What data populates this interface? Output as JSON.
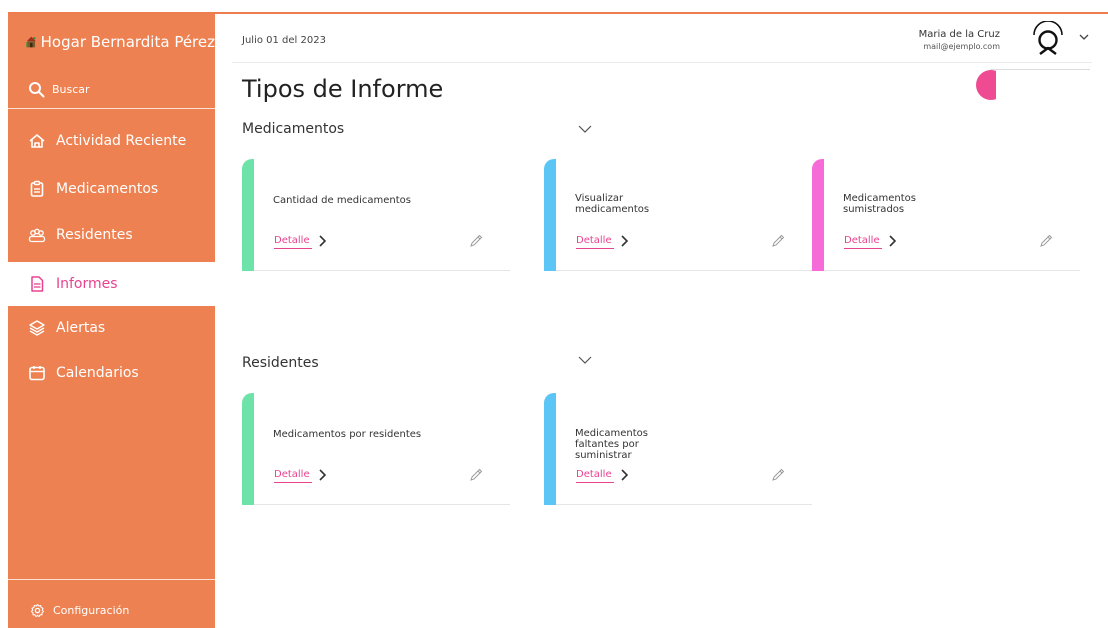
{
  "sidebar": {
    "brand": "Hogar Bernardita Pérez",
    "search_label": "Buscar",
    "items": [
      {
        "label": "Actividad Reciente",
        "icon": "home-icon"
      },
      {
        "label": "Medicamentos",
        "icon": "clipboard-icon"
      },
      {
        "label": "Residentes",
        "icon": "people-icon"
      },
      {
        "label": "Informes",
        "icon": "document-icon",
        "active": true
      },
      {
        "label": "Alertas",
        "icon": "layers-icon"
      },
      {
        "label": "Calendarios",
        "icon": "calendar-icon"
      }
    ],
    "config_label": "Configuración"
  },
  "header": {
    "date": "Julio 01 del 2023",
    "user_name": "Maria de la Cruz",
    "user_email": "mail@ejemplo.com"
  },
  "main": {
    "title": "Tipos de Informe",
    "sections": [
      {
        "title": "Medicamentos",
        "cards": [
          {
            "title": "Cantidad de medicamentos",
            "link": "Detalle",
            "color": "#6ee3a9"
          },
          {
            "title": "Visualizar medicamentos",
            "link": "Detalle",
            "color": "#5bc5f5"
          },
          {
            "title": "Medicamentos sumistrados",
            "link": "Detalle",
            "color": "#f76bd9"
          }
        ]
      },
      {
        "title": "Residentes",
        "cards": [
          {
            "title": "Medicamentos por residentes",
            "link": "Detalle",
            "color": "#6ee3a9"
          },
          {
            "title": "Medicamentos faltantes por suministrar",
            "link": "Detalle",
            "color": "#5bc5f5"
          }
        ]
      }
    ]
  },
  "colors": {
    "sidebar": "#ed8151",
    "accent": "#e8438f",
    "green": "#6ee3a9",
    "blue": "#5bc5f5",
    "pink": "#f76bd9"
  }
}
